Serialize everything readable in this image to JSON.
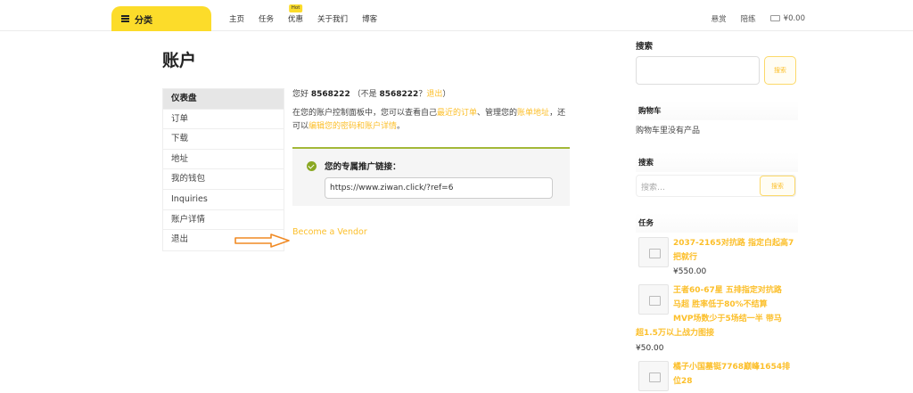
{
  "header": {
    "category_label": "分类",
    "nav": [
      {
        "label": "主页"
      },
      {
        "label": "任务"
      },
      {
        "label": "优惠",
        "badge": "Hot"
      },
      {
        "label": "关于我们"
      },
      {
        "label": "博客"
      }
    ],
    "right_links": [
      "悬赏",
      "陪练"
    ],
    "cart_total": "¥0.00"
  },
  "page": {
    "title": "账户"
  },
  "account_nav": [
    {
      "label": "仪表盘",
      "active": true
    },
    {
      "label": "订单"
    },
    {
      "label": "下载"
    },
    {
      "label": "地址"
    },
    {
      "label": "我的钱包"
    },
    {
      "label": "Inquiries"
    },
    {
      "label": "账户详情"
    },
    {
      "label": "退出"
    }
  ],
  "dashboard": {
    "greeting_prefix": "您好 ",
    "username": "8568222",
    "not_prefix": "（不是 ",
    "username2": "8568222",
    "question": "？",
    "logout_link": "退出",
    "close_paren": "）",
    "desc_1": "在您的账户控制面板中，您可以查看自己",
    "link_orders": "最近的订单",
    "desc_2": "、管理您的",
    "link_address": "账单地址",
    "desc_3": "，还可以",
    "link_edit": "编辑您的密码和账户详情",
    "desc_4": "。",
    "affiliate_title": "您的专属推广链接：",
    "affiliate_url": "https://www.ziwan.click/?ref=6",
    "vendor_link": "Become a Vendor"
  },
  "sidebar": {
    "search_title": "搜索",
    "search_button": "搜索",
    "cart_title": "购物车",
    "cart_empty": "购物车里没有产品",
    "search2_title": "搜索",
    "search2_placeholder": "搜索…",
    "search2_button": "搜索",
    "tasks_title": "任务",
    "products": [
      {
        "title_line1": "2037-2165对抗路 指定白起高7",
        "title_line2": "把就行",
        "price": "¥550.00"
      },
      {
        "title_line1": "王者60-67星 五排指定对抗路",
        "title_line2": "马超 胜率低于80%不结算",
        "title_line3": "MVP场数少于5场结一半 带马",
        "title_line4": "超1.5万以上战力图接",
        "price": "¥50.00"
      },
      {
        "title_line1": "橘子小国墓铤7768巅峰1654排",
        "title_line2": "位28"
      }
    ]
  },
  "colors": {
    "accent": "#fcdc2a",
    "link": "#fcbf2a",
    "success": "#8aa823"
  }
}
